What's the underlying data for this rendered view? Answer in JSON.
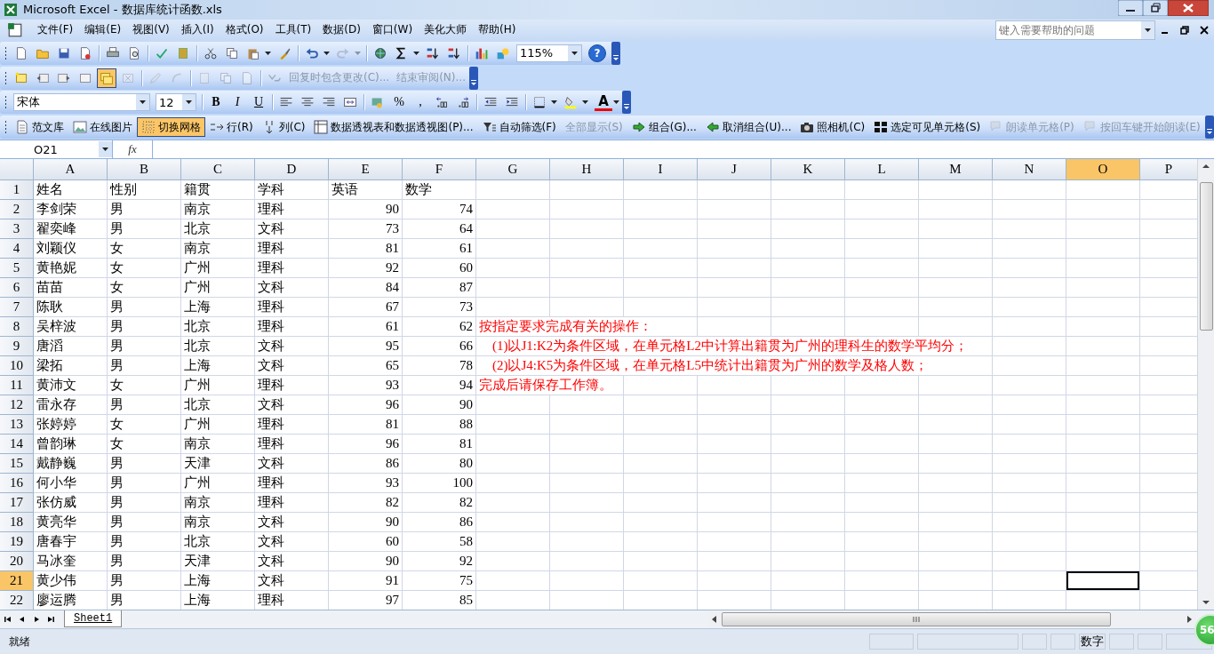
{
  "window": {
    "title": "Microsoft Excel - 数据库统计函数.xls"
  },
  "menu": [
    "文件(F)",
    "编辑(E)",
    "视图(V)",
    "插入(I)",
    "格式(O)",
    "工具(T)",
    "数据(D)",
    "窗口(W)",
    "美化大师",
    "帮助(H)"
  ],
  "help_box": {
    "placeholder": "键入需要帮助的问题"
  },
  "standard_toolbar": {
    "zoom": "115%",
    "help": "?"
  },
  "reviewing_toolbar": {
    "show_all_comments_selected": true,
    "items": [
      {
        "label": "回复时包含更改(C)...",
        "disabled": true
      },
      {
        "label": "结束审阅(N)...",
        "disabled": true
      }
    ]
  },
  "formatting_toolbar": {
    "font": "宋体",
    "size": "12",
    "styles": [
      "B",
      "I",
      "U"
    ],
    "percent": "%",
    "comma": ",",
    "font_color": "A"
  },
  "extra_toolbar": {
    "items": [
      {
        "label": "范文库",
        "disabled": false,
        "selected": false
      },
      {
        "label": "在线图片",
        "disabled": false,
        "selected": false
      },
      {
        "label": "切换网格",
        "disabled": false,
        "selected": true
      },
      {
        "label": "行(R)",
        "disabled": false,
        "selected": false
      },
      {
        "label": "列(C)",
        "disabled": false,
        "selected": false
      },
      {
        "label": "数据透视表和数据透视图(P)...",
        "disabled": false,
        "selected": false
      },
      {
        "label": "自动筛选(F)",
        "disabled": false,
        "selected": false
      },
      {
        "label": "全部显示(S)",
        "disabled": true,
        "selected": false
      },
      {
        "label": "组合(G)...",
        "disabled": false,
        "selected": false
      },
      {
        "label": "取消组合(U)...",
        "disabled": false,
        "selected": false
      },
      {
        "label": "照相机(C)",
        "disabled": false,
        "selected": false
      },
      {
        "label": "选定可见单元格(S)",
        "disabled": false,
        "selected": false
      },
      {
        "label": "朗读单元格(P)",
        "disabled": true,
        "selected": false
      },
      {
        "label": "按回车键开始朗读(E)",
        "disabled": true,
        "selected": false
      }
    ]
  },
  "name_box": "O21",
  "formula_bar": {
    "function_label": "fx"
  },
  "sheet": {
    "columns": [
      {
        "label": "A",
        "selected": false
      },
      {
        "label": "B",
        "selected": false
      },
      {
        "label": "C",
        "selected": false
      },
      {
        "label": "D",
        "selected": false
      },
      {
        "label": "E",
        "selected": false
      },
      {
        "label": "F",
        "selected": false
      },
      {
        "label": "G",
        "selected": false
      },
      {
        "label": "H",
        "selected": false
      },
      {
        "label": "I",
        "selected": false
      },
      {
        "label": "J",
        "selected": false
      },
      {
        "label": "K",
        "selected": false
      },
      {
        "label": "L",
        "selected": false
      },
      {
        "label": "M",
        "selected": false
      },
      {
        "label": "N",
        "selected": false
      },
      {
        "label": "O",
        "selected": true
      },
      {
        "label": "P",
        "selected": false
      }
    ],
    "rows": [
      {
        "number": "1",
        "selected": false,
        "cells": [
          "姓名",
          "性别",
          "籍贯",
          "学科",
          "英语",
          "数学"
        ]
      },
      {
        "number": "2",
        "selected": false,
        "cells": [
          "李剑荣",
          "男",
          "南京",
          "理科",
          "90",
          "74"
        ]
      },
      {
        "number": "3",
        "selected": false,
        "cells": [
          "翟奕峰",
          "男",
          "北京",
          "文科",
          "73",
          "64"
        ]
      },
      {
        "number": "4",
        "selected": false,
        "cells": [
          "刘颖仪",
          "女",
          "南京",
          "理科",
          "81",
          "61"
        ]
      },
      {
        "number": "5",
        "selected": false,
        "cells": [
          "黄艳妮",
          "女",
          "广州",
          "理科",
          "92",
          "60"
        ]
      },
      {
        "number": "6",
        "selected": false,
        "cells": [
          "苗苗",
          "女",
          "广州",
          "文科",
          "84",
          "87"
        ]
      },
      {
        "number": "7",
        "selected": false,
        "cells": [
          "陈耿",
          "男",
          "上海",
          "理科",
          "67",
          "73"
        ]
      },
      {
        "number": "8",
        "selected": false,
        "cells": [
          "吴梓波",
          "男",
          "北京",
          "理科",
          "61",
          "62"
        ],
        "note": "按指定要求完成有关的操作："
      },
      {
        "number": "9",
        "selected": false,
        "cells": [
          "唐滔",
          "男",
          "北京",
          "文科",
          "95",
          "66"
        ],
        "note": "　(1)以J1:K2为条件区域，在单元格L2中计算出籍贯为广州的理科生的数学平均分；"
      },
      {
        "number": "10",
        "selected": false,
        "cells": [
          "梁拓",
          "男",
          "上海",
          "文科",
          "65",
          "78"
        ],
        "note": "　(2)以J4:K5为条件区域，在单元格L5中统计出籍贯为广州的数学及格人数；"
      },
      {
        "number": "11",
        "selected": false,
        "cells": [
          "黄沛文",
          "女",
          "广州",
          "理科",
          "93",
          "94"
        ],
        "note": "完成后请保存工作簿。"
      },
      {
        "number": "12",
        "selected": false,
        "cells": [
          "雷永存",
          "男",
          "北京",
          "文科",
          "96",
          "90"
        ]
      },
      {
        "number": "13",
        "selected": false,
        "cells": [
          "张婷婷",
          "女",
          "广州",
          "理科",
          "81",
          "88"
        ]
      },
      {
        "number": "14",
        "selected": false,
        "cells": [
          "曾韵琳",
          "女",
          "南京",
          "理科",
          "96",
          "81"
        ]
      },
      {
        "number": "15",
        "selected": false,
        "cells": [
          "戴静巍",
          "男",
          "天津",
          "文科",
          "86",
          "80"
        ]
      },
      {
        "number": "16",
        "selected": false,
        "cells": [
          "何小华",
          "男",
          "广州",
          "理科",
          "93",
          "100"
        ]
      },
      {
        "number": "17",
        "selected": false,
        "cells": [
          "张仿威",
          "男",
          "南京",
          "理科",
          "82",
          "82"
        ]
      },
      {
        "number": "18",
        "selected": false,
        "cells": [
          "黄亮华",
          "男",
          "南京",
          "文科",
          "90",
          "86"
        ]
      },
      {
        "number": "19",
        "selected": false,
        "cells": [
          "唐春宇",
          "男",
          "北京",
          "文科",
          "60",
          "58"
        ]
      },
      {
        "number": "20",
        "selected": false,
        "cells": [
          "马冰奎",
          "男",
          "天津",
          "文科",
          "90",
          "92"
        ]
      },
      {
        "number": "21",
        "selected": true,
        "cells": [
          "黄少伟",
          "男",
          "上海",
          "文科",
          "91",
          "75"
        ]
      },
      {
        "number": "22",
        "selected": false,
        "cells": [
          "廖运腾",
          "男",
          "上海",
          "理科",
          "97",
          "85"
        ]
      }
    ]
  },
  "sheet_tabs": [
    {
      "label": "Sheet1",
      "selected": true
    }
  ],
  "status_bar": {
    "text": "就绪",
    "indicator": "数字"
  },
  "badge": "56"
}
